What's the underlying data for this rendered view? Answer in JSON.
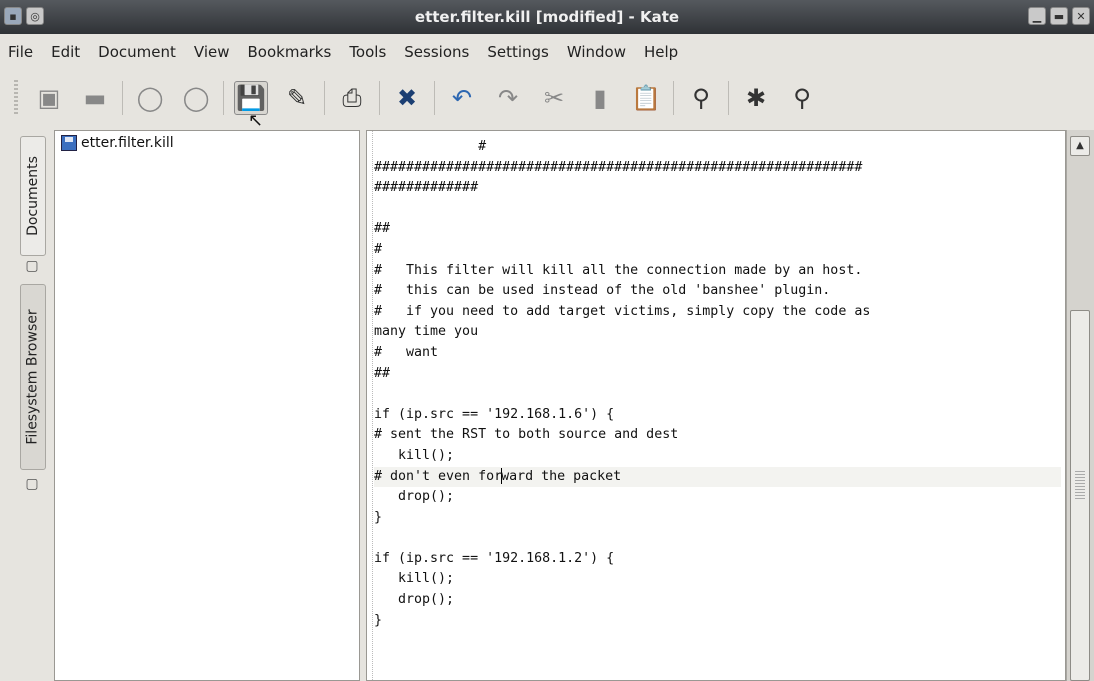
{
  "window": {
    "title": "etter.filter.kill [modified] - Kate",
    "controls": {
      "minimize": "minimize",
      "maximize": "maximize",
      "close": "✕"
    }
  },
  "menu": [
    {
      "label": "File"
    },
    {
      "label": "Edit"
    },
    {
      "label": "Document"
    },
    {
      "label": "View"
    },
    {
      "label": "Bookmarks"
    },
    {
      "label": "Tools"
    },
    {
      "label": "Sessions"
    },
    {
      "label": "Settings"
    },
    {
      "label": "Window"
    },
    {
      "label": "Help"
    }
  ],
  "toolbar": {
    "icons": [
      "new-document-icon",
      "close-document-icon",
      "back-icon",
      "forward-icon",
      "save-icon",
      "save-as-icon",
      "print-icon",
      "close-icon",
      "undo-icon",
      "redo-icon",
      "cut-icon",
      "copy-icon",
      "paste-icon",
      "find-icon",
      "settings-icon",
      "zoom-icon"
    ]
  },
  "side_tabs": {
    "documents": "Documents",
    "filesystem": "Filesystem Browser"
  },
  "documents": {
    "items": [
      {
        "name": "etter.filter.kill"
      }
    ]
  },
  "editor": {
    "lines": [
      "             #",
      "#############################################################",
      "#############",
      "",
      "##",
      "#",
      "#   This filter will kill all the connection made by an host.",
      "#   this can be used instead of the old 'banshee' plugin.",
      "#   if you need to add target victims, simply copy the code as",
      "many time you",
      "#   want",
      "##",
      "",
      "if (ip.src == '192.168.1.6') {",
      "# sent the RST to both source and dest",
      "   kill();",
      "# don't even forward the packet",
      "   drop();",
      "}",
      "",
      "if (ip.src == '192.168.1.2') {",
      "   kill();",
      "   drop();",
      "}"
    ],
    "current_line_index": 16,
    "current_line_before_caret": "# don't even for",
    "current_line_after_caret": "ward the packet"
  },
  "colors": {
    "titlebar": "#3a3d41",
    "background": "#e6e4df",
    "editor_bg": "#ffffff"
  }
}
